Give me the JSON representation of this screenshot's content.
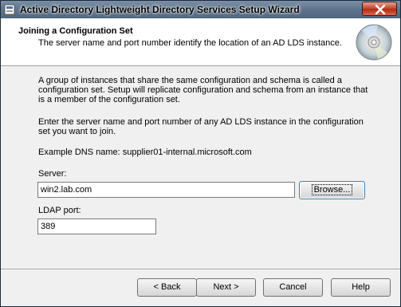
{
  "window": {
    "title": "Active Directory Lightweight Directory Services Setup Wizard"
  },
  "header": {
    "title": "Joining a Configuration Set",
    "subtitle": "The server name and port number identify the location of an AD LDS instance."
  },
  "content": {
    "paragraph1": "A group of instances that share the same configuration and schema is called a configuration set. Setup will replicate configuration and schema from an instance that is a member of the configuration set.",
    "paragraph2": "Enter the server name and port number of any AD LDS instance in the configuration set you want to join.",
    "example": "Example DNS name: supplier01-internal.microsoft.com",
    "server_label": "Server:",
    "server_value": "win2.lab.com",
    "browse_label": "Browse...",
    "port_label": "LDAP port:",
    "port_value": "389"
  },
  "footer": {
    "back_label": "< Back",
    "next_label": "Next >",
    "cancel_label": "Cancel",
    "help_label": "Help"
  },
  "icons": {
    "app": "setup-wizard-icon",
    "close": "close-icon",
    "header": "cd-disc-icon"
  }
}
